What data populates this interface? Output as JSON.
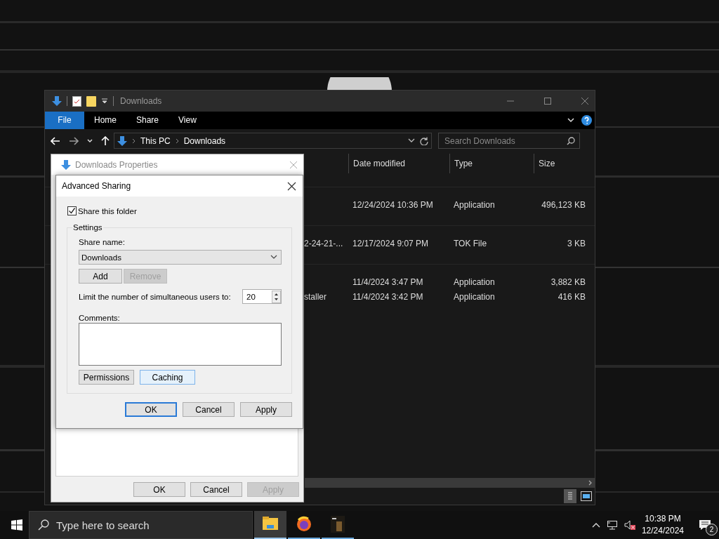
{
  "explorer": {
    "title": "Downloads",
    "ribbon_tabs": [
      {
        "label": "File",
        "selected": true
      },
      {
        "label": "Home",
        "selected": false
      },
      {
        "label": "Share",
        "selected": false
      },
      {
        "label": "View",
        "selected": false
      }
    ],
    "breadcrumb": [
      "This PC",
      "Downloads"
    ],
    "search": {
      "placeholder": "Search Downloads"
    },
    "columns": [
      "Date modified",
      "Type",
      "Size"
    ],
    "groups": [
      {
        "rows": [
          {
            "date": "12/24/2024 10:36 PM",
            "type": "Application",
            "size": "496,123 KB"
          }
        ]
      },
      {
        "rows": [
          {
            "name": "2-24-21-...",
            "date": "12/17/2024 9:07 PM",
            "type": "TOK File",
            "size": "3 KB"
          }
        ]
      },
      {
        "rows": [
          {
            "date": "11/4/2024 3:47 PM",
            "type": "Application",
            "size": "3,882 KB"
          },
          {
            "name": "staller",
            "date": "11/4/2024 3:42 PM",
            "type": "Application",
            "size": "416 KB"
          }
        ]
      }
    ]
  },
  "properties_dialog": {
    "title": "Downloads Properties",
    "buttons": [
      {
        "label": "OK",
        "disabled": false
      },
      {
        "label": "Cancel",
        "disabled": false
      },
      {
        "label": "Apply",
        "disabled": true
      }
    ]
  },
  "advanced_sharing": {
    "title": "Advanced Sharing",
    "share_this_folder": {
      "label": "Share this folder",
      "checked": true
    },
    "settings_label": "Settings",
    "share_name_label": "Share name:",
    "share_name": "Downloads",
    "name_buttons": [
      {
        "label": "Add",
        "disabled": false
      },
      {
        "label": "Remove",
        "disabled": true
      }
    ],
    "limit_label": "Limit the number of simultaneous users to:",
    "limit_value": "20",
    "comments_label": "Comments:",
    "option_buttons": [
      {
        "label": "Permissions",
        "hovered": false
      },
      {
        "label": "Caching",
        "hovered": true
      }
    ],
    "footer_buttons": [
      {
        "label": "OK",
        "default": true
      },
      {
        "label": "Cancel",
        "default": false
      },
      {
        "label": "Apply",
        "default": false
      }
    ]
  },
  "taskbar": {
    "search": {
      "placeholder": "Type here to search"
    },
    "apps": [
      {
        "kind": "folder",
        "active": true
      },
      {
        "kind": "browser",
        "active": false
      },
      {
        "kind": "app",
        "active": false
      }
    ],
    "time": "10:38 PM",
    "date": "12/24/2024",
    "notifications": "2"
  }
}
